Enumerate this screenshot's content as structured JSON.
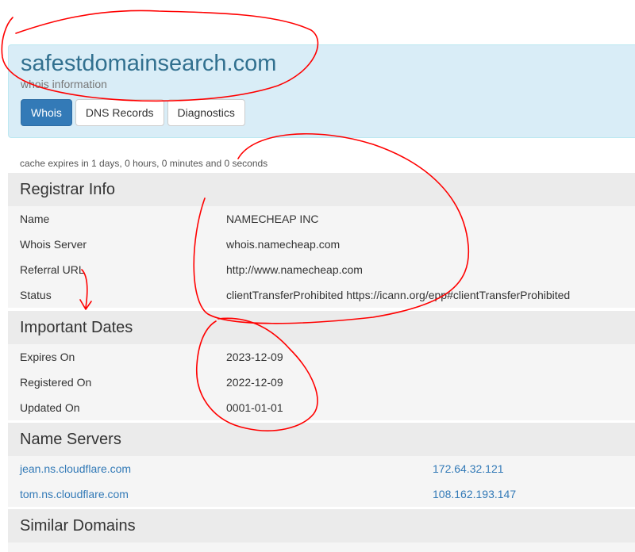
{
  "site": {
    "title": "safestdomainsearch.com",
    "subtitle": "whois information"
  },
  "tabs": [
    {
      "label": "Whois",
      "active": true
    },
    {
      "label": "DNS Records",
      "active": false
    },
    {
      "label": "Diagnostics",
      "active": false
    }
  ],
  "cache_note": "cache expires in 1 days, 0 hours, 0 minutes and 0 seconds",
  "registrar": {
    "heading": "Registrar Info",
    "rows": [
      {
        "label": "Name",
        "value": "NAMECHEAP INC"
      },
      {
        "label": "Whois Server",
        "value": "whois.namecheap.com"
      },
      {
        "label": "Referral URL",
        "value": "http://www.namecheap.com"
      },
      {
        "label": "Status",
        "value": "clientTransferProhibited https://icann.org/epp#clientTransferProhibited"
      }
    ]
  },
  "dates": {
    "heading": "Important Dates",
    "rows": [
      {
        "label": "Expires On",
        "value": "2023-12-09"
      },
      {
        "label": "Registered On",
        "value": "2022-12-09"
      },
      {
        "label": "Updated On",
        "value": "0001-01-01"
      }
    ]
  },
  "nameservers": {
    "heading": "Name Servers",
    "rows": [
      {
        "host": "jean.ns.cloudflare.com",
        "ip": "172.64.32.121"
      },
      {
        "host": "tom.ns.cloudflare.com",
        "ip": "108.162.193.147"
      }
    ]
  },
  "similar": {
    "heading": "Similar Domains"
  },
  "colors": {
    "accent": "#337ab7",
    "header_bg": "#d9edf7",
    "annotation": "#ff0000"
  }
}
